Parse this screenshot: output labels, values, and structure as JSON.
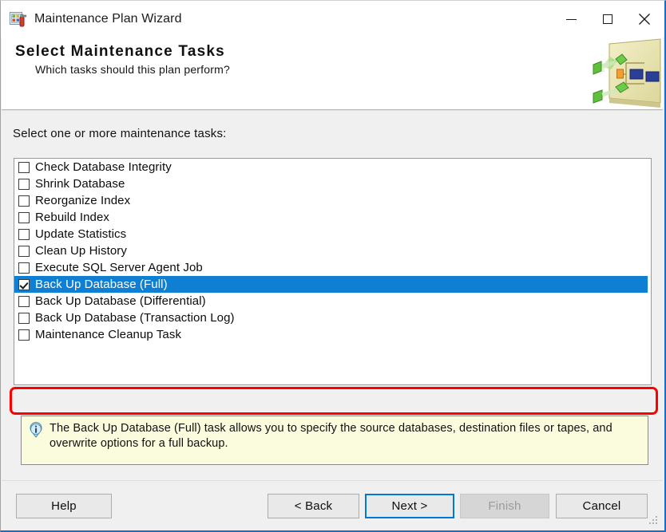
{
  "window": {
    "title": "Maintenance Plan Wizard",
    "icon": "maintenance-plan-icon",
    "controls": {
      "minimize": "minimize-icon",
      "maximize": "maximize-icon",
      "close": "close-icon"
    }
  },
  "banner": {
    "title": "Select Maintenance Tasks",
    "subtitle": "Which tasks should this plan perform?",
    "art": "maintenance-plan-diagram-art"
  },
  "main": {
    "list_label": "Select one or more maintenance tasks:",
    "tasks": [
      {
        "label": "Check Database Integrity",
        "checked": false,
        "selected": false
      },
      {
        "label": "Shrink Database",
        "checked": false,
        "selected": false
      },
      {
        "label": "Reorganize Index",
        "checked": false,
        "selected": false
      },
      {
        "label": "Rebuild Index",
        "checked": false,
        "selected": false
      },
      {
        "label": "Update Statistics",
        "checked": false,
        "selected": false
      },
      {
        "label": "Clean Up History",
        "checked": false,
        "selected": false
      },
      {
        "label": "Execute SQL Server Agent Job",
        "checked": false,
        "selected": false
      },
      {
        "label": "Back Up Database (Full)",
        "checked": true,
        "selected": true
      },
      {
        "label": "Back Up Database (Differential)",
        "checked": false,
        "selected": false
      },
      {
        "label": "Back Up Database (Transaction Log)",
        "checked": false,
        "selected": false
      },
      {
        "label": "Maintenance Cleanup Task",
        "checked": false,
        "selected": false
      }
    ]
  },
  "info": {
    "icon": "information-icon",
    "text": "The Back Up Database (Full) task allows you to specify the source databases, destination files or tapes, and overwrite options for a full backup."
  },
  "footer": {
    "help": "Help",
    "back": "< Back",
    "next": "Next >",
    "finish": "Finish",
    "cancel": "Cancel"
  },
  "colors": {
    "selection_blue": "#0f7fd4",
    "focus_blue": "#0078d7",
    "annotation_red": "#ff0000",
    "info_background": "#fbfbdd",
    "window_chrome": "#f0f0f0"
  }
}
